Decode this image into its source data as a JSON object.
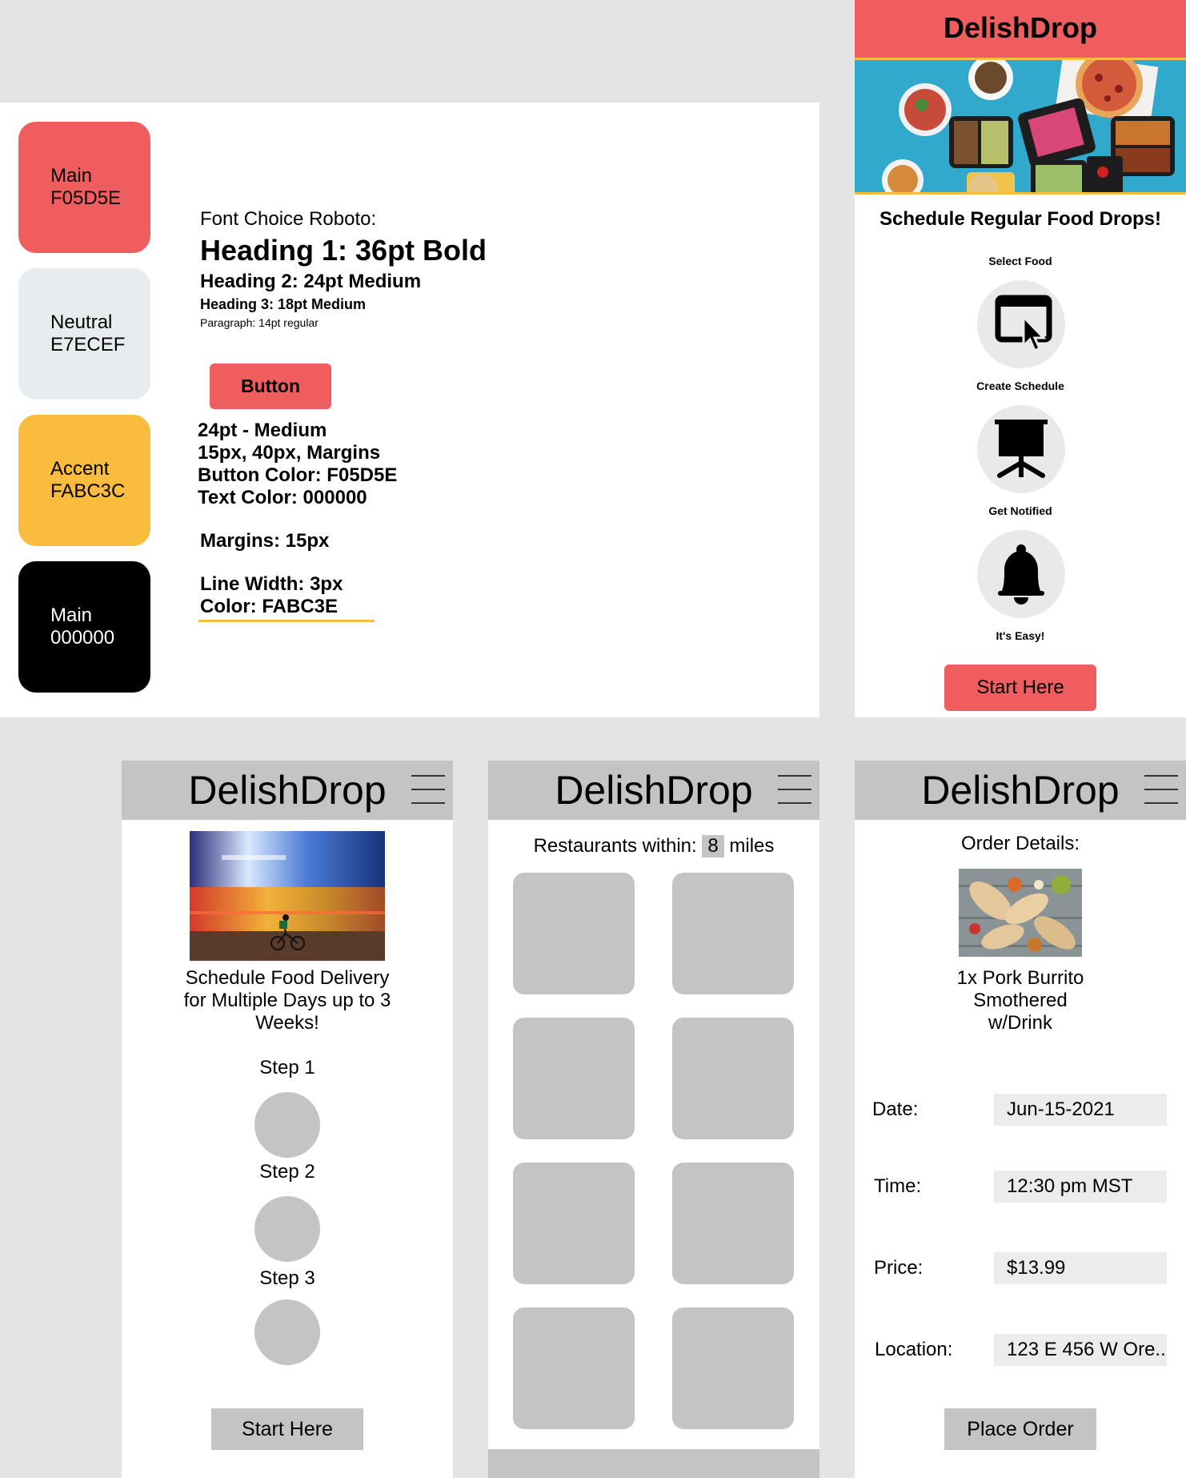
{
  "colors": {
    "main": "#F05D5E",
    "neutral": "#E7ECEF",
    "accent": "#FABC3C",
    "black": "#000000",
    "line": "#FABC3E",
    "placeholder": "#C4C4C4",
    "canvas": "#E4E4E4"
  },
  "style_guide": {
    "swatches": [
      {
        "name": "Main",
        "code": "F05D5E"
      },
      {
        "name": "Neutral",
        "code": "E7ECEF"
      },
      {
        "name": "Accent",
        "code": "FABC3C"
      },
      {
        "name": "Main",
        "code": "000000"
      }
    ],
    "font_choice": "Font Choice Roboto:",
    "heading1": "Heading 1: 36pt Bold",
    "heading2": "Heading 2: 24pt Medium",
    "heading3": "Heading 3: 18pt Medium",
    "paragraph": "Paragraph: 14pt regular",
    "button_label": "Button",
    "button_specs": [
      "24pt - Medium",
      "15px, 40px, Margins",
      "Button Color: F05D5E",
      "Text Color: 000000"
    ],
    "margins": "Margins: 15px",
    "line_specs": [
      "Line Width: 3px",
      "Color: FABC3E"
    ]
  },
  "landing": {
    "brand": "DelishDrop",
    "hero_image": "food-delivery-containers-photo",
    "tagline": "Schedule Regular Food Drops!",
    "steps": [
      {
        "caption": "Select Food",
        "icon": "computer-cursor-icon"
      },
      {
        "caption": "Create Schedule",
        "icon": "presentation-board-icon"
      },
      {
        "caption": "Get Notified",
        "icon": "bell-icon"
      }
    ],
    "final_caption": "It's Easy!",
    "cta": "Start Here"
  },
  "screen1": {
    "brand": "DelishDrop",
    "image": "night-city-cyclist-photo",
    "description": "Schedule Food Delivery for Multiple Days up to 3 Weeks!",
    "steps": [
      "Step 1",
      "Step 2",
      "Step 3"
    ],
    "cta": "Start Here"
  },
  "screen2": {
    "brand": "DelishDrop",
    "radius_prefix": "Restaurants within:",
    "radius_value": "8",
    "radius_suffix": "miles",
    "tiles": 8
  },
  "screen3": {
    "brand": "DelishDrop",
    "title": "Order Details:",
    "image": "burritos-photo",
    "item": "1x Pork Burrito Smothered w/Drink",
    "fields": [
      {
        "label": "Date:",
        "value": "Jun-15-2021"
      },
      {
        "label": "Time:",
        "value": "12:30 pm MST"
      },
      {
        "label": "Price:",
        "value": "$13.99"
      },
      {
        "label": "Location:",
        "value": "123 E 456 W Ore.."
      }
    ],
    "cta": "Place Order"
  }
}
